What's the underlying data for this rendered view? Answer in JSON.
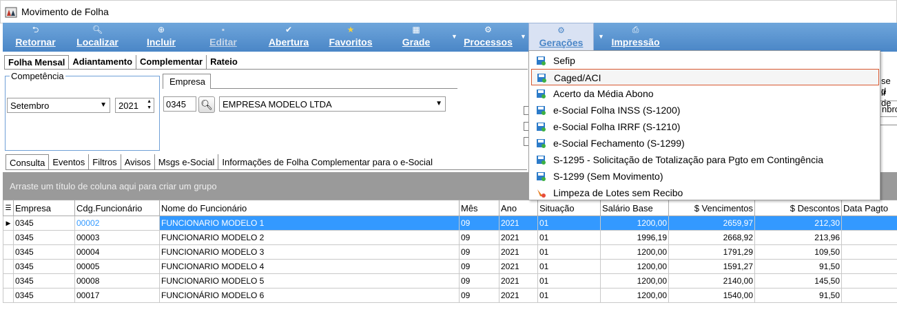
{
  "window": {
    "title": "Movimento de Folha"
  },
  "toolbar": {
    "buttons": [
      {
        "label": "Retornar",
        "icon": "arrow-return-icon"
      },
      {
        "label": "Localizar",
        "icon": "search-icon"
      },
      {
        "label": "Incluir",
        "icon": "plus-circle-icon"
      },
      {
        "label": "Editar",
        "icon": "edit-icon"
      },
      {
        "label": "Abertura",
        "icon": "check-doc-icon"
      },
      {
        "label": "Favoritos",
        "icon": "star-icon"
      },
      {
        "label": "Grade",
        "icon": "grid-icon"
      },
      {
        "label": "Processos",
        "icon": "process-icon"
      },
      {
        "label": "Gerações",
        "icon": "gear-icon"
      },
      {
        "label": "Impressão",
        "icon": "printer-icon"
      }
    ]
  },
  "main_tabs": [
    "Folha Mensal",
    "Adiantamento",
    "Complementar",
    "Rateio"
  ],
  "competencia": {
    "legend": "Competência",
    "month": "Setembro",
    "year": "2021"
  },
  "empresa": {
    "tab_label": "Empresa",
    "code": "0345",
    "name": "EMPRESA MODELO LTDA"
  },
  "right_fragments": {
    "line1": "se d",
    "line2": "ir de",
    "select_text": "nbro"
  },
  "sub_tabs": [
    "Consulta",
    "Eventos",
    "Filtros",
    "Avisos",
    "Msgs e-Social",
    "Informações de Folha Complementar para o e-Social"
  ],
  "group_area_text": "Arraste um título de coluna aqui para criar um grupo",
  "grid": {
    "columns": [
      "Empresa",
      "Cdg.Funcionário",
      "Nome do Funcionário",
      "Mês",
      "Ano",
      "Situação",
      "Salário Base",
      "$ Vencimentos",
      "$ Descontos",
      "Data Pagto"
    ],
    "rows": [
      [
        "0345",
        "00002",
        "FUNCIONARIO MODELO 1",
        "09",
        "2021",
        "01",
        "1200,00",
        "2659,97",
        "212,30",
        ""
      ],
      [
        "0345",
        "00003",
        "FUNCIONARIO MODELO 2",
        "09",
        "2021",
        "01",
        "1996,19",
        "2668,92",
        "213,96",
        ""
      ],
      [
        "0345",
        "00004",
        "FUNCIONARIO MODELO 3",
        "09",
        "2021",
        "01",
        "1200,00",
        "1791,29",
        "109,50",
        ""
      ],
      [
        "0345",
        "00005",
        "FUNCIONARIO MODELO 4",
        "09",
        "2021",
        "01",
        "1200,00",
        "1591,27",
        "91,50",
        ""
      ],
      [
        "0345",
        "00008",
        "FUNCIONARIO MODELO 5",
        "09",
        "2021",
        "01",
        "1200,00",
        "2140,00",
        "145,50",
        ""
      ],
      [
        "0345",
        "00017",
        "FUNCIONÁRIO MODELO 6",
        "09",
        "2021",
        "01",
        "1200,00",
        "1540,00",
        "91,50",
        ""
      ]
    ]
  },
  "geracoes_menu": {
    "items": [
      {
        "label": "Sefip",
        "icon": "save-icon"
      },
      {
        "label": "Caged/ACI",
        "icon": "save-icon"
      },
      {
        "label": "Acerto da Média Abono",
        "icon": "save-icon"
      },
      {
        "label": "e-Social Folha INSS (S-1200)",
        "icon": "save-icon"
      },
      {
        "label": "e-Social Folha IRRF (S-1210)",
        "icon": "save-icon"
      },
      {
        "label": "e-Social Fechamento (S-1299)",
        "icon": "save-icon"
      },
      {
        "label": "S-1295 - Solicitação de Totalização para Pgto em Contingência",
        "icon": "save-icon"
      },
      {
        "label": "S-1299 (Sem Movimento)",
        "icon": "save-icon"
      },
      {
        "label": "Limpeza de Lotes sem Recibo",
        "icon": "broom-icon"
      }
    ]
  },
  "colors": {
    "toolbar": "#4a86c7",
    "selection": "#3399ff",
    "menu_highlight": "#d7572e"
  }
}
